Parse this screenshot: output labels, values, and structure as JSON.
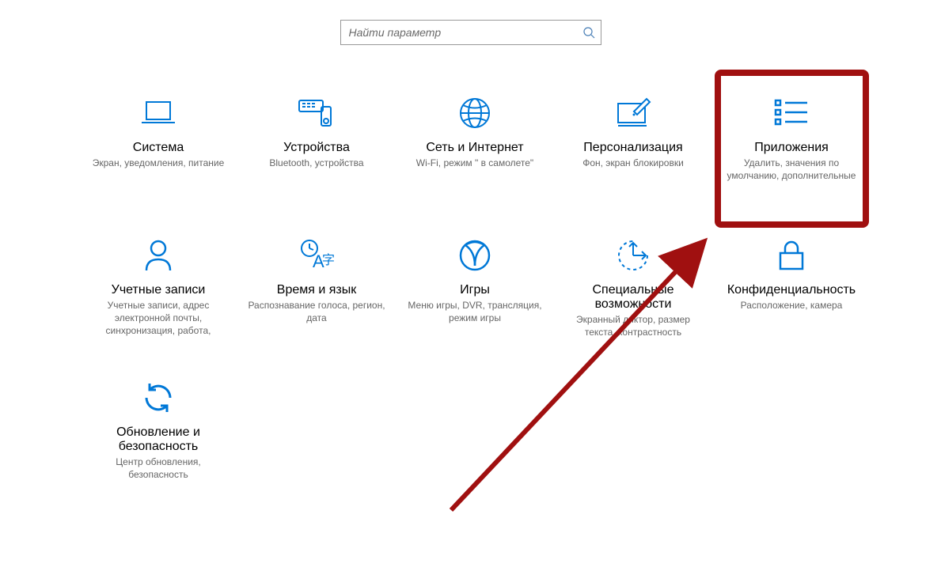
{
  "search": {
    "placeholder": "Найти параметр"
  },
  "tiles": [
    {
      "title": "Система",
      "desc": "Экран, уведомления, питание"
    },
    {
      "title": "Устройства",
      "desc": "Bluetooth, устройства"
    },
    {
      "title": "Сеть и Интернет",
      "desc": "Wi-Fi, режим \" в самолете\""
    },
    {
      "title": "Персонализация",
      "desc": "Фон, экран блокировки"
    },
    {
      "title": "Приложения",
      "desc": "Удалить, значения по умолчанию, дополнительные"
    },
    {
      "title": "Учетные записи",
      "desc": "Учетные записи, адрес электронной почты, синхронизация, работа,"
    },
    {
      "title": "Время и язык",
      "desc": "Распознавание голоса, регион, дата"
    },
    {
      "title": "Игры",
      "desc": "Меню игры, DVR, трансляция, режим игры"
    },
    {
      "title": "Специальные возможности",
      "desc": "Экранный диктор, размер текста, контрастность"
    },
    {
      "title": "Конфиденциальность",
      "desc": "Расположение, камера"
    },
    {
      "title": "Обновление и безопасность",
      "desc": "Центр обновления, безопасность"
    }
  ],
  "colors": {
    "accent": "#0078D7",
    "annotation": "#a01010"
  }
}
